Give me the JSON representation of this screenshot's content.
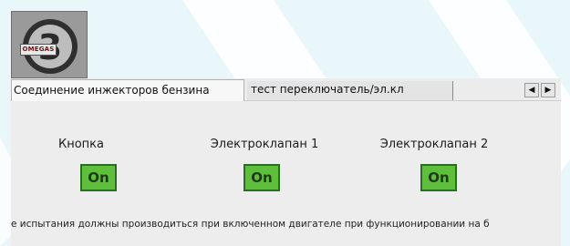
{
  "logo": {
    "numeral": "3",
    "text": "OMEGAS"
  },
  "tabs": [
    {
      "label": "Соединение инжекторов бензина"
    },
    {
      "label": "тест переключатель/эл.кл"
    }
  ],
  "scroll": {
    "left_glyph": "◀",
    "right_glyph": "▶"
  },
  "controls": [
    {
      "label": "Кнопка",
      "button": "On"
    },
    {
      "label": "Электроклапан 1",
      "button": "On"
    },
    {
      "label": "Электроклапан 2",
      "button": "On"
    }
  ],
  "footer": {
    "text": "е испытания должны производиться при включенном двигателе при функционировании на б"
  },
  "colors": {
    "button_on": "#5fbf3c",
    "background": "#e9f7fb",
    "panel": "#ececec"
  }
}
